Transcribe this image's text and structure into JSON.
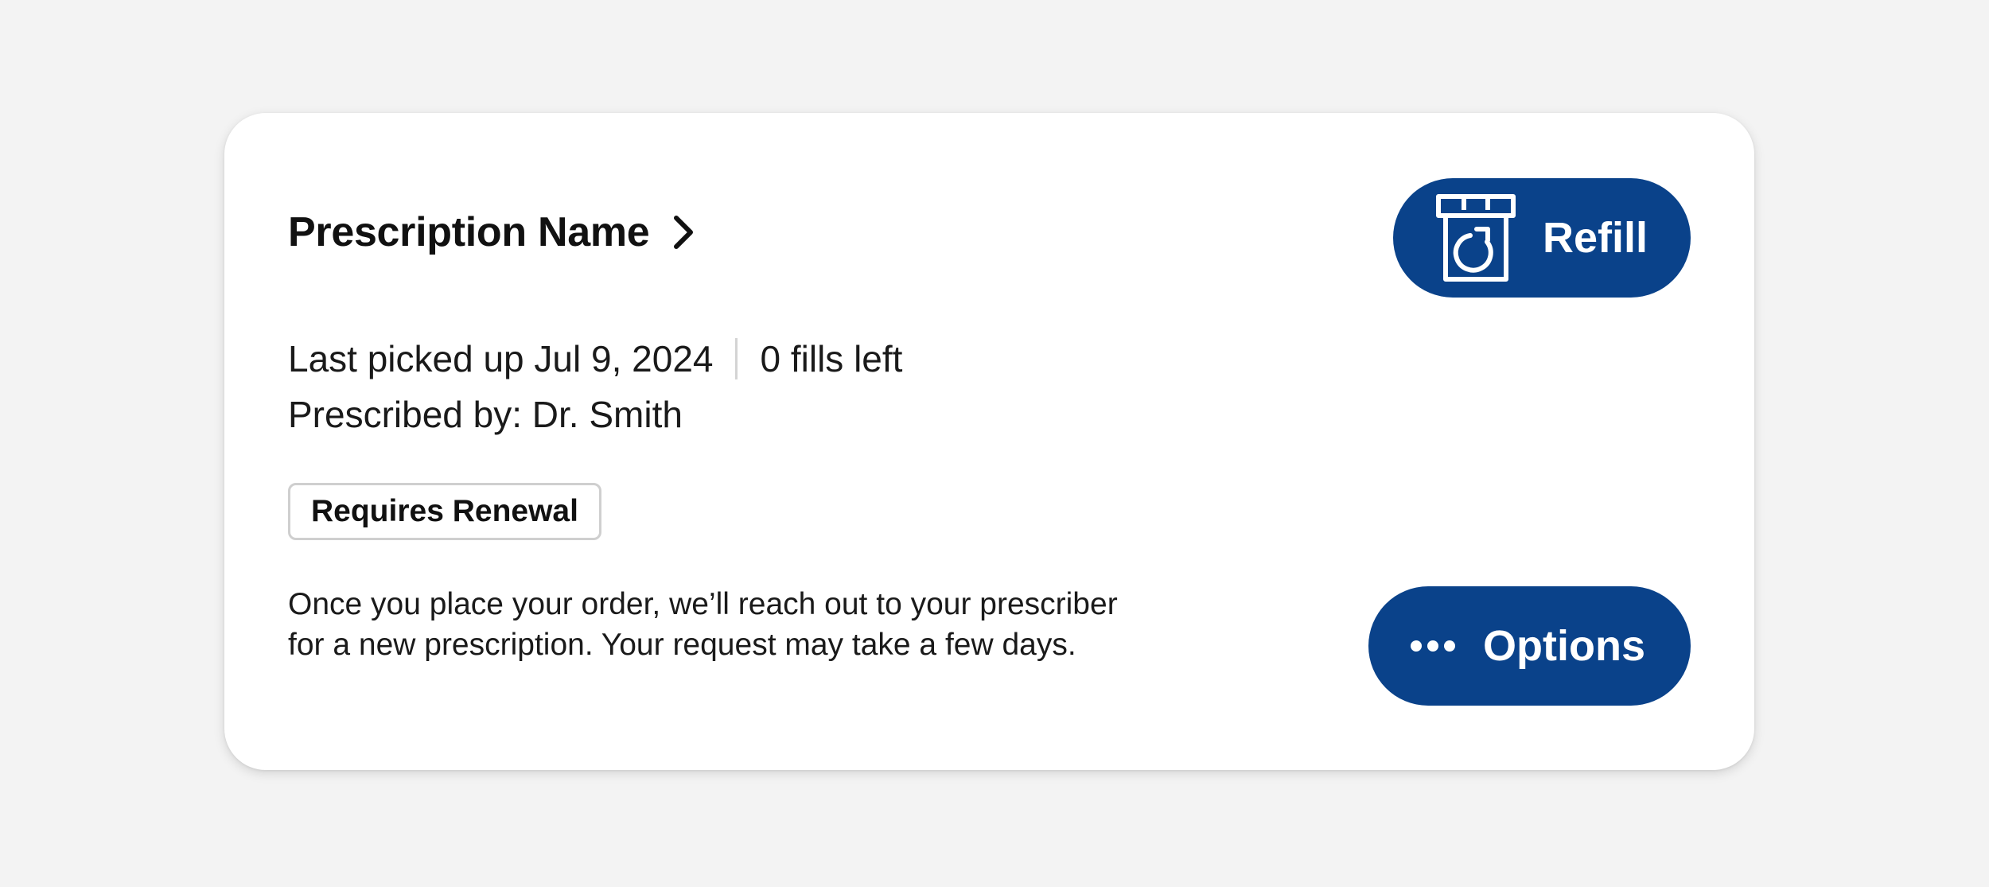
{
  "card": {
    "title": "Prescription Name",
    "last_picked_up": "Last picked up Jul 9, 2024",
    "fills_left": "0 fills left",
    "prescribed_by": "Prescribed by: Dr. Smith",
    "badge": "Requires Renewal",
    "description": "Once you place your order, we’ll reach out to your prescriber for a new prescription. Your request may take a few days."
  },
  "actions": {
    "refill_label": "Refill",
    "options_label": "Options"
  },
  "icons": {
    "title_chevron": "chevron-right-icon",
    "refill": "pill-bottle-refill-icon",
    "options": "more-horizontal-icon"
  },
  "colors": {
    "page_background": "#f3f3f3",
    "card_background": "#ffffff",
    "button_primary": "#0a428a",
    "button_text": "#ffffff",
    "badge_border": "#cfcfcf",
    "divider": "#d4d4d4"
  }
}
